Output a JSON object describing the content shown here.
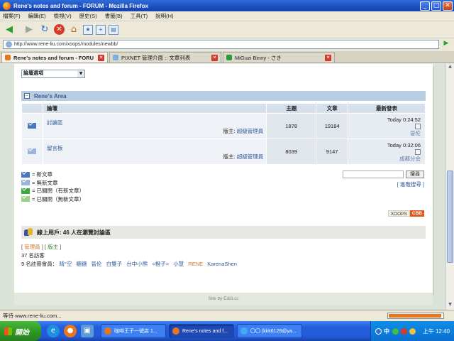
{
  "window": {
    "title": "Rene's notes and forum - FORUM - Mozilla Firefox",
    "controls": [
      "_",
      "□",
      "✕"
    ]
  },
  "menu": [
    "檔案(F)",
    "編輯(E)",
    "檢視(V)",
    "歷史(S)",
    "書籤(B)",
    "工具(T)",
    "說明(H)"
  ],
  "toolbar": {
    "icons": [
      "back-icon",
      "forward-icon",
      "reload-icon",
      "stop-icon",
      "home-icon",
      "bookmark-icon",
      "new-tab-icon",
      "sidebar-icon"
    ]
  },
  "url": {
    "value": "http://www.rene-liu.com/xoops/modules/newbb/"
  },
  "tabs": [
    {
      "label": "Rene's notes and forum - FORUM",
      "active": true,
      "color": "#e8761f"
    },
    {
      "label": "PIXNET 管理介面 :: 文章列表",
      "active": false,
      "color": "#7ab0e0"
    },
    {
      "label": "MiGuzi Binny - さき",
      "active": false,
      "color": "#2a9a3a"
    }
  ],
  "forum": {
    "jump_select": "論壇選項",
    "category": "Rene's Area",
    "headers": {
      "forum": "論壇",
      "topics": "主題",
      "posts": "文章",
      "last_post": "最新發表"
    },
    "rows": [
      {
        "name": "討論區",
        "mod_label": "版主:",
        "mod_name": "超級管理員",
        "topics": "1878",
        "posts": "19184",
        "last_time": "Today 0:24:52",
        "last_user": "晉伦",
        "icon_color": "#4a78c0"
      },
      {
        "name": "留言板",
        "mod_label": "版主:",
        "mod_name": "超級管理員",
        "topics": "8039",
        "posts": "9147",
        "last_time": "Today 0:32:06",
        "last_user": "成都分会",
        "icon_color": "#9ab4dc"
      }
    ],
    "legend": [
      {
        "text": "= 新文章",
        "color": "#4a78c0"
      },
      {
        "text": "= 無新文章",
        "color": "#9ab4dc"
      },
      {
        "text": "= 已關閉（有新文章）",
        "color": "#3aa83a"
      },
      {
        "text": "= 已關閉（無新文章）",
        "color": "#9ad08a"
      }
    ],
    "search_button": "搜尋",
    "advanced_search": "[ 進階搜尋 ]",
    "xoops_badge": [
      "XOOPS",
      "CBB"
    ]
  },
  "online": {
    "title": "線上用戶: 46 人在瀏覽討論區",
    "admin_label": "管理員",
    "mod_label": "版主",
    "guests": "37 名訪客",
    "members_label": "9 名註冊會員：",
    "members": [
      "晴°空",
      "糖糖",
      "晉伦",
      "白雙子",
      "台中小熊",
      "<橙子>",
      "小慧",
      "RENE",
      "KarenaShen"
    ]
  },
  "footer": "Site by Eddi.cc",
  "status": {
    "text": "等待 www.rene-liu.com...",
    "progress": 0.95
  },
  "taskbar": {
    "start": "開始",
    "tasks": [
      {
        "label": "咖啡王子一號店 1...",
        "active": false,
        "color": "#e8761f"
      },
      {
        "label": "Rene's notes and f...",
        "active": true,
        "color": "#e8761f"
      },
      {
        "label": "〇〇 (kkk6128@ya...",
        "active": false,
        "color": "#44aaee"
      }
    ],
    "ime": "中",
    "clock": "上午 12:40"
  }
}
